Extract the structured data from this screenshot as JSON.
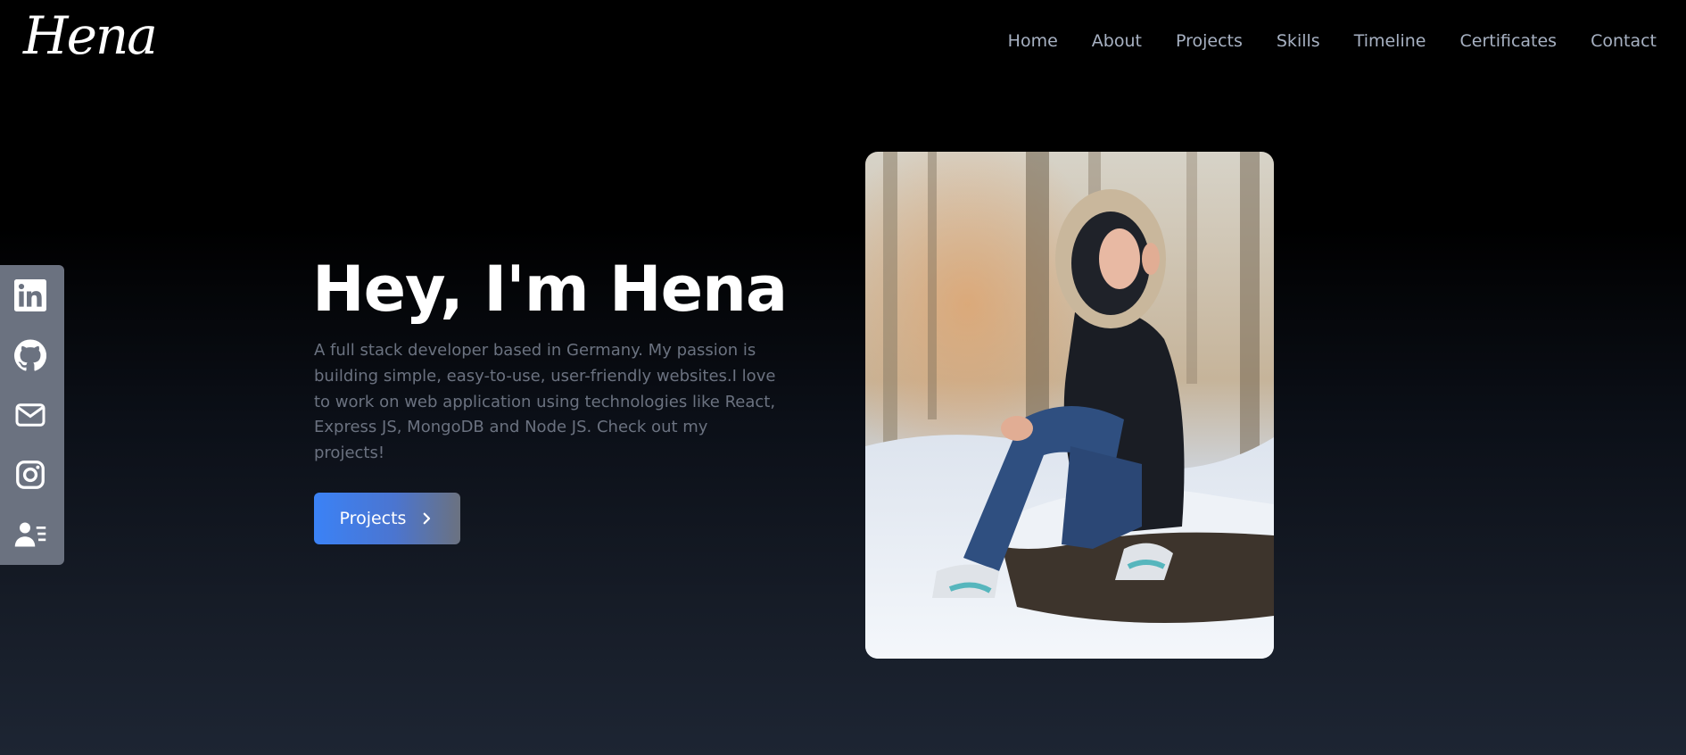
{
  "brand": {
    "logo_text": "Hena"
  },
  "nav": {
    "items": [
      {
        "label": "Home"
      },
      {
        "label": "About"
      },
      {
        "label": "Projects"
      },
      {
        "label": "Skills"
      },
      {
        "label": "Timeline"
      },
      {
        "label": "Certificates"
      },
      {
        "label": "Contact"
      }
    ]
  },
  "social": {
    "items": [
      {
        "icon": "linkedin-icon"
      },
      {
        "icon": "github-icon"
      },
      {
        "icon": "mail-icon"
      },
      {
        "icon": "instagram-icon"
      },
      {
        "icon": "resume-icon"
      }
    ]
  },
  "hero": {
    "title": "Hey, I'm Hena",
    "description": "A full stack developer based in Germany. My passion is building simple, easy-to-use, user-friendly websites.I love to work on web application using technologies like React, Express JS, MongoDB and Node JS. Check out my projects!",
    "cta_label": "Projects",
    "cta_icon": "chevron-right-icon"
  },
  "colors": {
    "accent_blue": "#3b82f6",
    "muted_text": "#6b7280",
    "nav_text": "#a7b1c2",
    "social_bar": "#6b7280",
    "background_top": "#000000",
    "background_bottom": "#1d2533"
  }
}
